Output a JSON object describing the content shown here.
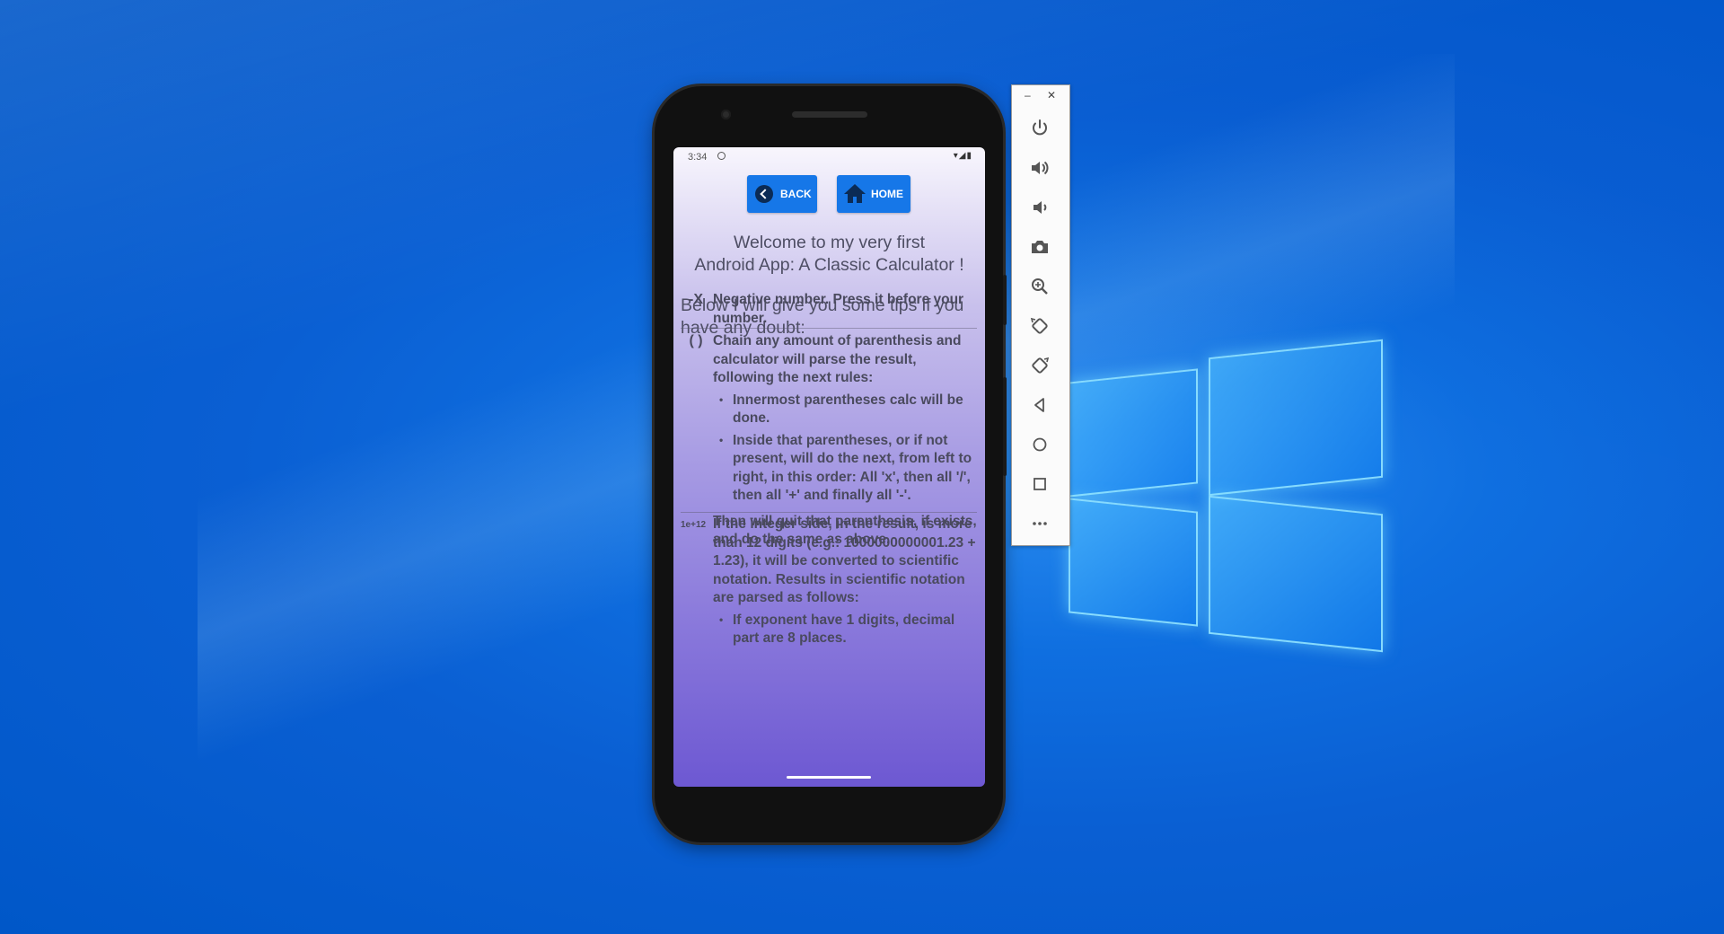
{
  "phone": {
    "status_time": "3:34",
    "back_label": "BACK",
    "home_label": "HOME",
    "welcome_line1": "Welcome to my very first",
    "welcome_line2": "Android App: A Classic Calculator !",
    "intro": "Below I will give you some tips if you have any doubt:",
    "tips": [
      {
        "symbol": "-X",
        "text": "Negative number. Press it before your number."
      },
      {
        "symbol": "( )",
        "text": "Chain any amount of parenthesis and calculator will parse the result, following the next rules:",
        "bullets": [
          "Innermost parentheses calc will be done.",
          "Inside that parentheses, or if not present, will do the next, from left to right, in this order: All 'x', then all '/', then all '+' and finally all '-'."
        ],
        "after": "Then will quit that parenthesis, if exists, and do the same as above."
      },
      {
        "symbol": "1e+12",
        "text": "If the integer side, in the result, is more than 12 digits (e.g.: 1000000000001.23 + 1.23), it will be converted to scientific notation. Results in scientific notation are parsed as follows:",
        "bullets": [
          "If exponent have 1 digits, decimal part are 8 places."
        ]
      }
    ]
  },
  "toolbar": {
    "minimize_label": "–",
    "close_label": "✕",
    "buttons": [
      "power-icon",
      "volume-up-icon",
      "volume-down-icon",
      "camera-icon",
      "zoom-icon",
      "rotate-left-icon",
      "rotate-right-icon",
      "back-triangle-icon",
      "home-circle-icon",
      "overview-square-icon",
      "more-icon"
    ]
  },
  "colors": {
    "button_blue": "#1677e8",
    "text_gray": "#4e4e64",
    "desktop_blue": "#0a5fd3"
  }
}
